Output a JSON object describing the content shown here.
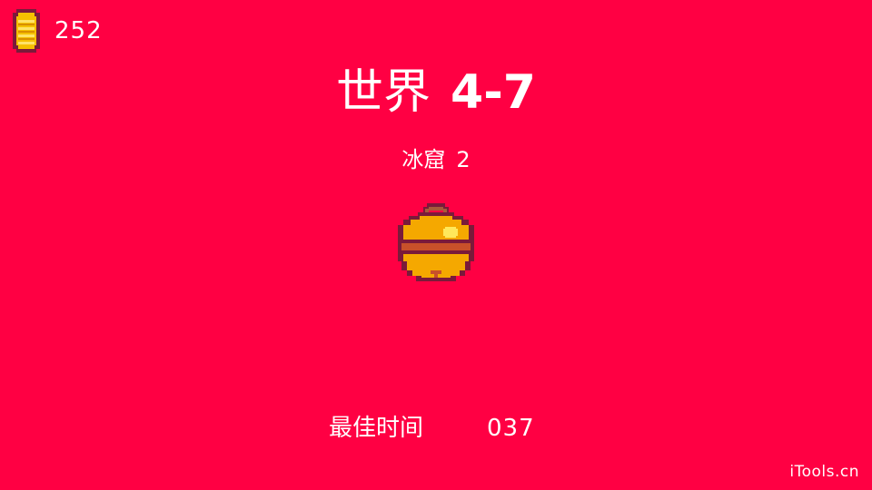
{
  "hud": {
    "coin_icon": "coin-icon",
    "coin_count": "252"
  },
  "level": {
    "world_word": "世界",
    "world_number": "4-7",
    "name": "冰窟",
    "name_number": "2",
    "collectible_icon": "golden-bell-icon"
  },
  "best_time": {
    "label": "最佳时间",
    "value": "037"
  },
  "watermark": "iTools.cn",
  "colors": {
    "background": "#ff0043",
    "text": "#ffffff",
    "coin_gold": "#f5c000",
    "bell_gold": "#f5a800",
    "outline": "#7a1a3a"
  }
}
